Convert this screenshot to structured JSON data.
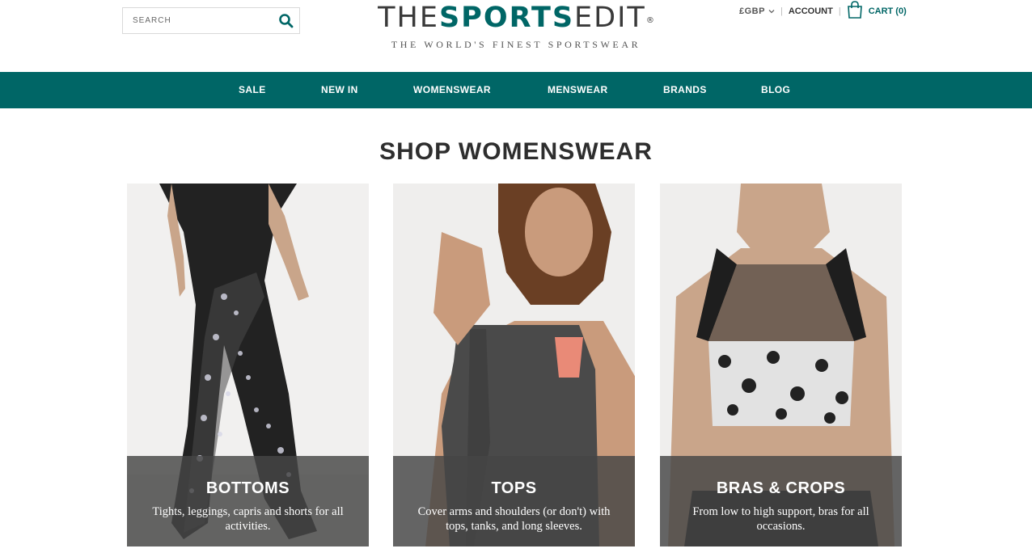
{
  "search": {
    "placeholder": "SEARCH",
    "icon": "search-icon"
  },
  "logo": {
    "light_1": "THE",
    "bold": "SPORTS",
    "light_2": "EDIT",
    "reg": "®",
    "tagline": "THE WORLD'S FINEST SPORTSWEAR"
  },
  "utility": {
    "currency": "£GBP",
    "account": "ACCOUNT",
    "cart": "CART (0)",
    "separator": "|"
  },
  "nav": {
    "items": [
      "SALE",
      "NEW IN",
      "WOMENSWEAR",
      "MENSWEAR",
      "BRANDS",
      "BLOG"
    ]
  },
  "page_title": "SHOP WOMENSWEAR",
  "categories": [
    {
      "title": "BOTTOMS",
      "description": "Tights, leggings, capris and shorts for all activities."
    },
    {
      "title": "TOPS",
      "description": "Cover arms and shoulders (or don't) with tops, tanks, and long sleeves."
    },
    {
      "title": "BRAS & CROPS",
      "description": "From low to high support, bras for all occasions."
    }
  ],
  "colors": {
    "brand": "#006666",
    "text": "#2e2e2e",
    "overlay": "#464646"
  }
}
